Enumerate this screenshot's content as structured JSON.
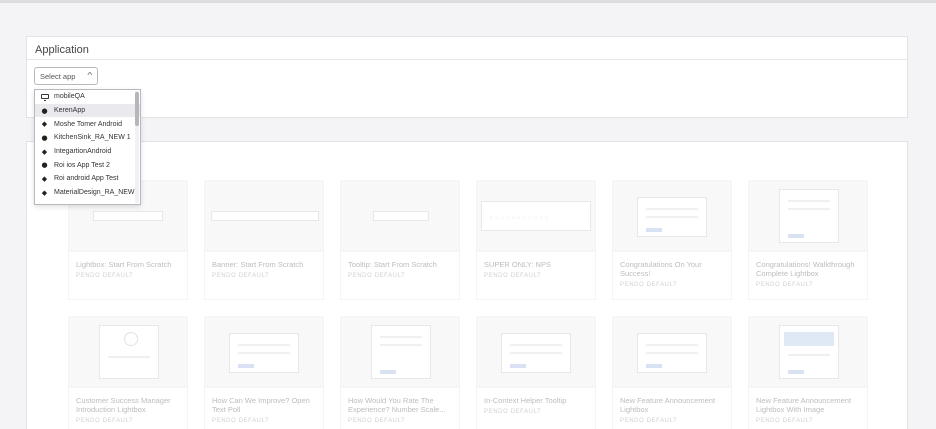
{
  "application": {
    "section_title": "Application",
    "select_value": "Select app",
    "apps": [
      {
        "label": "mobileQA",
        "icon": "monitor-icon"
      },
      {
        "label": "KerenApp",
        "icon": "apple-icon"
      },
      {
        "label": "Moshe Tomer Android",
        "icon": "android-icon"
      },
      {
        "label": "KitchenSink_RA_NEW 1",
        "icon": "apple-icon"
      },
      {
        "label": "IntegartionAndroid",
        "icon": "android-icon"
      },
      {
        "label": "Roi ios App Test 2",
        "icon": "apple-icon"
      },
      {
        "label": "Roi android App Test",
        "icon": "android-icon"
      },
      {
        "label": "MaterialDesign_RA_NEW",
        "icon": "android-icon"
      }
    ]
  },
  "templates": [
    {
      "title": "Lightbox: Start From Scratch",
      "subtitle": "PENDO DEFAULT",
      "preview": "bar-sm"
    },
    {
      "title": "Banner: Start From Scratch",
      "subtitle": "PENDO DEFAULT",
      "preview": "bar-lg"
    },
    {
      "title": "Tooltip: Start From Scratch",
      "subtitle": "PENDO DEFAULT",
      "preview": "bar-xs"
    },
    {
      "title": "SUPER ONLY: NPS",
      "subtitle": "PENDO DEFAULT",
      "preview": "nps"
    },
    {
      "title": "Congratulations On Your Success!",
      "subtitle": "PENDO DEFAULT",
      "preview": "box"
    },
    {
      "title": "Congratulations! Walkthrough Complete Lightbox",
      "subtitle": "PENDO DEFAULT",
      "preview": "tall"
    },
    {
      "title": "Customer Success Manager Introduction Lightbox",
      "subtitle": "PENDO DEFAULT",
      "preview": "tall-avatar"
    },
    {
      "title": "How Can We Improve? Open Text Poll",
      "subtitle": "PENDO DEFAULT",
      "preview": "box"
    },
    {
      "title": "How Would You Rate The Experience? Number Scale...",
      "subtitle": "PENDO DEFAULT",
      "preview": "tall"
    },
    {
      "title": "In-Context Helper Tooltip",
      "subtitle": "PENDO DEFAULT",
      "preview": "box-small"
    },
    {
      "title": "New Feature Announcement Lightbox",
      "subtitle": "PENDO DEFAULT",
      "preview": "box"
    },
    {
      "title": "New Feature Announcement Lightbox With Image",
      "subtitle": "PENDO DEFAULT",
      "preview": "tall-image"
    }
  ]
}
